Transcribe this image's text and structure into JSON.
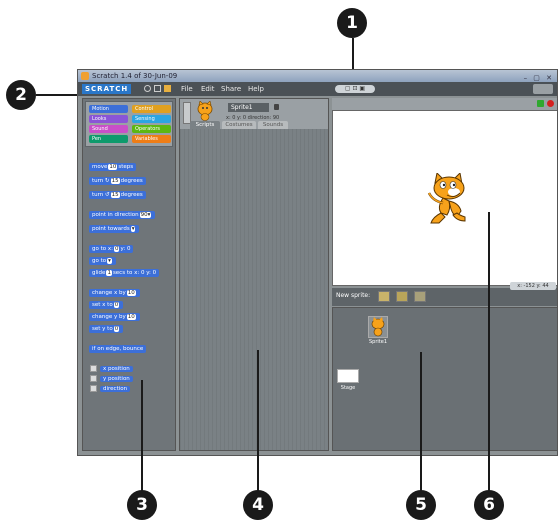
{
  "callouts": [
    "1",
    "2",
    "3",
    "4",
    "5",
    "6"
  ],
  "window": {
    "title": "Scratch 1.4 of 30-Jun-09",
    "logo": "SCRATCH",
    "menus": [
      "File",
      "Edit",
      "Share",
      "Help"
    ],
    "mode_buttons": "▢ ⊡ ▣"
  },
  "palette": {
    "categories": [
      {
        "label": "Motion",
        "color": "#3c6fd8"
      },
      {
        "label": "Control",
        "color": "#e0a020"
      },
      {
        "label": "Looks",
        "color": "#8a55d7"
      },
      {
        "label": "Sensing",
        "color": "#2ca5e2"
      },
      {
        "label": "Sound",
        "color": "#c94fc9"
      },
      {
        "label": "Operators",
        "color": "#5cb712"
      },
      {
        "label": "Pen",
        "color": "#0e9a6c"
      },
      {
        "label": "Variables",
        "color": "#ee7d16"
      }
    ],
    "blocks": [
      {
        "pre": "move",
        "arg": "10",
        "post": "steps"
      },
      {
        "pre": "turn ↻",
        "arg": "15",
        "post": "degrees"
      },
      {
        "pre": "turn ↺",
        "arg": "15",
        "post": "degrees"
      },
      {
        "pre": "point in direction",
        "arg": "90▾",
        "post": ""
      },
      {
        "pre": "point towards",
        "arg": "▾",
        "post": ""
      },
      {
        "pre": "go to x:",
        "arg": "0",
        "post": "y: 0"
      },
      {
        "pre": "go to",
        "arg": "▾",
        "post": ""
      },
      {
        "pre": "glide",
        "arg": "1",
        "post": "secs to x: 0 y: 0"
      },
      {
        "pre": "change x by",
        "arg": "10",
        "post": ""
      },
      {
        "pre": "set x to",
        "arg": "0",
        "post": ""
      },
      {
        "pre": "change y by",
        "arg": "10",
        "post": ""
      },
      {
        "pre": "set y to",
        "arg": "0",
        "post": ""
      },
      {
        "pre": "if on edge, bounce",
        "arg": "",
        "post": ""
      }
    ],
    "reporters": [
      "x position",
      "y position",
      "direction"
    ]
  },
  "sprite_info": {
    "name": "Sprite1",
    "coords": "x: 0  y: 0  direction: 90",
    "tabs": [
      "Scripts",
      "Costumes",
      "Sounds"
    ]
  },
  "stage": {
    "readout": "x: -152  y: 44"
  },
  "sprite_list": {
    "new_sprite_label": "New sprite:",
    "sprites": [
      "Sprite1"
    ],
    "stage_label": "Stage"
  },
  "colors": {
    "accent": "#2a77c9",
    "go_flag": "#2fa82f",
    "stop": "#d42020"
  }
}
